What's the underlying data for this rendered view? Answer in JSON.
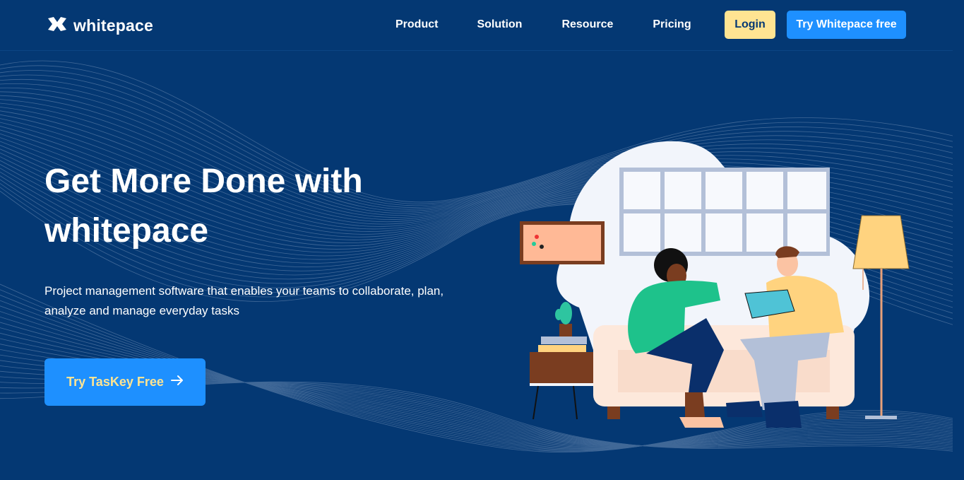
{
  "brand": {
    "name": "whitepace",
    "icon": "whitepace-logo-icon"
  },
  "nav": {
    "items": [
      {
        "label": "Product"
      },
      {
        "label": "Solution"
      },
      {
        "label": "Resource"
      },
      {
        "label": "Pricing"
      }
    ],
    "login_label": "Login",
    "try_label": "Try Whitepace free"
  },
  "hero": {
    "title": "Get More Done with whitepace",
    "subtitle": "Project management software that enables your teams to collaborate, plan, analyze and manage everyday tasks",
    "cta_label": "Try TasKey Free",
    "cta_icon": "arrow-right-icon"
  },
  "colors": {
    "background": "#043873",
    "accent_blue": "#1e90ff",
    "accent_yellow": "#FFE492",
    "text": "#ffffff"
  }
}
